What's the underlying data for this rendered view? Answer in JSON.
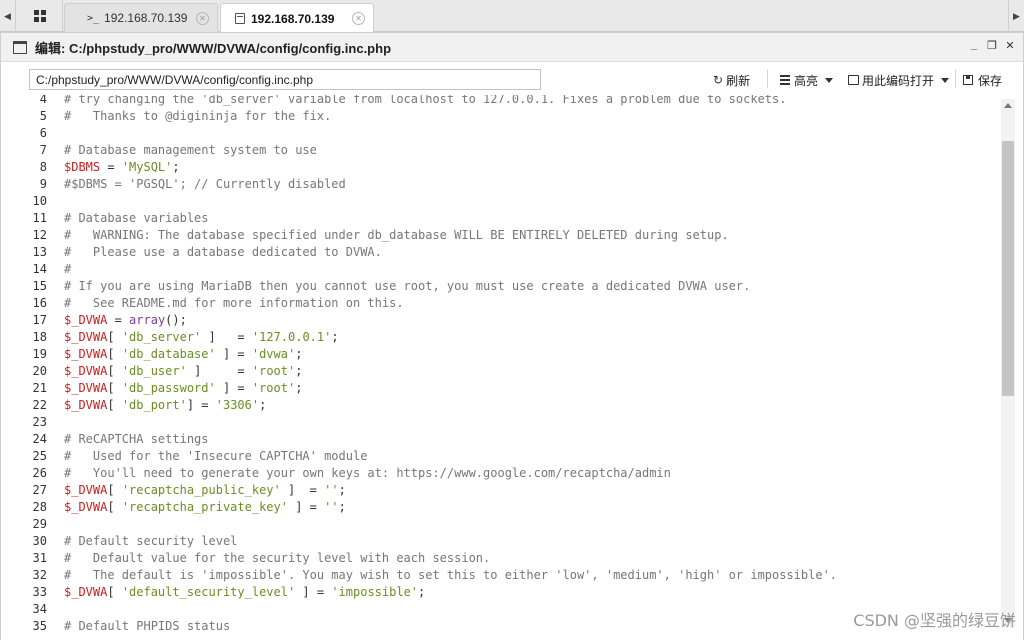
{
  "tabs": [
    {
      "icon": "terminal-icon",
      "label": "192.168.70.139",
      "active": false
    },
    {
      "icon": "document-icon",
      "label": "192.168.70.139",
      "active": true
    }
  ],
  "window": {
    "title": "编辑: C:/phpstudy_pro/WWW/DVWA/config/config.inc.php",
    "controls": {
      "minimize": "_",
      "restore": "❐",
      "close": "✕"
    }
  },
  "toolbar": {
    "path_value": "C:/phpstudy_pro/WWW/DVWA/config/config.inc.php",
    "refresh_label": "刷新",
    "highlight_label": "高亮",
    "open_encoding_label": "用此编码打开",
    "save_label": "保存"
  },
  "code_lines": [
    {
      "n": "4",
      "t": "# try changing the 'db_server' variable from localhost to 127.0.0.1. Fixes a problem due to sockets."
    },
    {
      "n": "5",
      "t": "#   Thanks to @digininja for the fix."
    },
    {
      "n": "6",
      "t": ""
    },
    {
      "n": "7",
      "t": "# Database management system to use"
    },
    {
      "n": "8",
      "t": "$DBMS = 'MySQL';"
    },
    {
      "n": "9",
      "t": "#$DBMS = 'PGSQL'; // Currently disabled"
    },
    {
      "n": "10",
      "t": ""
    },
    {
      "n": "11",
      "t": "# Database variables"
    },
    {
      "n": "12",
      "t": "#   WARNING: The database specified under db_database WILL BE ENTIRELY DELETED during setup."
    },
    {
      "n": "13",
      "t": "#   Please use a database dedicated to DVWA."
    },
    {
      "n": "14",
      "t": "#"
    },
    {
      "n": "15",
      "t": "# If you are using MariaDB then you cannot use root, you must use create a dedicated DVWA user."
    },
    {
      "n": "16",
      "t": "#   See README.md for more information on this."
    },
    {
      "n": "17",
      "t": "$_DVWA = array();"
    },
    {
      "n": "18",
      "t": "$_DVWA[ 'db_server' ]   = '127.0.0.1';"
    },
    {
      "n": "19",
      "t": "$_DVWA[ 'db_database' ] = 'dvwa';"
    },
    {
      "n": "20",
      "t": "$_DVWA[ 'db_user' ]     = 'root';"
    },
    {
      "n": "21",
      "t": "$_DVWA[ 'db_password' ] = 'root';"
    },
    {
      "n": "22",
      "t": "$_DVWA[ 'db_port'] = '3306';"
    },
    {
      "n": "23",
      "t": ""
    },
    {
      "n": "24",
      "t": "# ReCAPTCHA settings"
    },
    {
      "n": "25",
      "t": "#   Used for the 'Insecure CAPTCHA' module"
    },
    {
      "n": "26",
      "t": "#   You'll need to generate your own keys at: https://www.google.com/recaptcha/admin"
    },
    {
      "n": "27",
      "t": "$_DVWA[ 'recaptcha_public_key' ]  = '';"
    },
    {
      "n": "28",
      "t": "$_DVWA[ 'recaptcha_private_key' ] = '';"
    },
    {
      "n": "29",
      "t": ""
    },
    {
      "n": "30",
      "t": "# Default security level"
    },
    {
      "n": "31",
      "t": "#   Default value for the security level with each session."
    },
    {
      "n": "32",
      "t": "#   The default is 'impossible'. You may wish to set this to either 'low', 'medium', 'high' or impossible'."
    },
    {
      "n": "33",
      "t": "$_DVWA[ 'default_security_level' ] = 'impossible';"
    },
    {
      "n": "34",
      "t": ""
    },
    {
      "n": "35",
      "t": "# Default PHPIDS status"
    }
  ],
  "watermark": "CSDN @坚强的绿豆饼",
  "colors": {
    "variable": "#c81e1e",
    "string": "#6b8e23",
    "function": "#7a3da0",
    "comment": "#777777"
  }
}
